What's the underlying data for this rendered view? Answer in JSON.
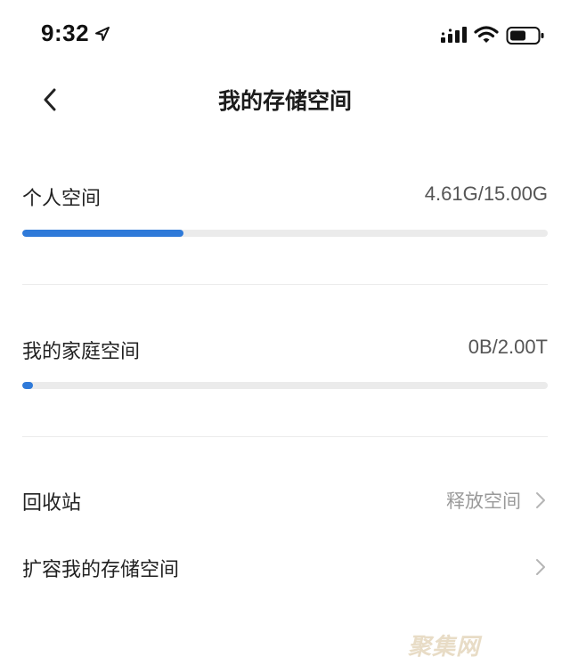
{
  "status_bar": {
    "time": "9:32"
  },
  "nav": {
    "title": "我的存储空间"
  },
  "personal_space": {
    "label": "个人空间",
    "usage": "4.61G/15.00G",
    "used_fraction": 0.307
  },
  "family_space": {
    "label": "我的家庭空间",
    "usage": "0B/2.00T",
    "used_fraction": 0.02
  },
  "recycle_bin": {
    "label": "回收站",
    "action": "释放空间"
  },
  "expand_storage": {
    "label": "扩容我的存储空间"
  },
  "watermark": "聚集网",
  "colors": {
    "accent": "#2f7ad9",
    "track": "#ebebeb",
    "secondary_text": "#9a9a9a"
  }
}
